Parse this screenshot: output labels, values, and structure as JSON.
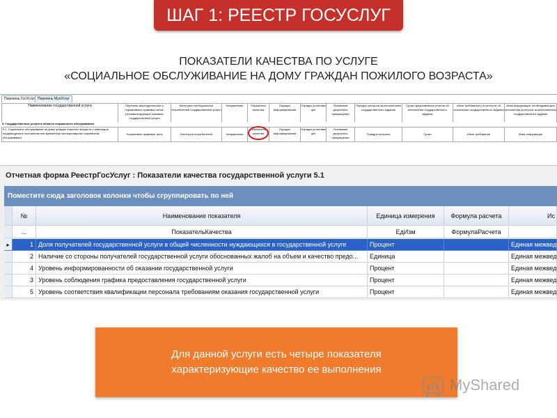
{
  "header": {
    "title": "ШАГ 1: РЕЕСТР ГОСУСЛУГ"
  },
  "subtitle": {
    "line1": "ПОКАЗАТЕЛИ КАЧЕСТВА ПО УСЛУГЕ",
    "line2": "«СОЦИАЛЬНОЕ ОБСЛУЖИВАНИЕ НА ДОМУ ГРАЖДАН ПОЖИЛОГО ВОЗРАСТА»"
  },
  "registry": {
    "tabs": [
      "Перечень ГосУслуг",
      "Перечень МунУслуг"
    ],
    "headers": [
      "Наименование государственной услуги",
      "Перечень законодательных и нормативных правовых актов, регламентирующих оказание государственной услуги",
      "Категории потенциальных потребителей государственной услуги",
      "Направления",
      "Показатели качества",
      "Порядок информирования",
      "Порядок установки цен",
      "Основания досрочного прекращения",
      "Порядок контроля за исполнением государственного задания",
      "Сроки представления отчетов об исполнении государственного задания",
      "Иные требования к отчетности об исполнении государственного задания",
      "Иная информация, необходимая для исполнения (контроля за исполнением) государственного задания"
    ],
    "section": "5. Государственные услуги в области социального обслуживания",
    "row_name": "5.1. Социальное обслуживание на дому граждан пожилого возраста и инвалидов, нуждающихся в постоянном или временном нестационарном социальном обслуживании",
    "row_cells": [
      "Нормативно правовые акты",
      "Категории потребителей",
      "Направления",
      "Показатели качества",
      "Порядок информирования",
      "Порядок установки цен",
      "Основания досрочного прекращения",
      "Порядок контроля",
      "Сроки",
      "Иные требования",
      "Иная информация"
    ]
  },
  "grid": {
    "title": "Отчетная форма РеестрГосУслуг : Показатели качества государственной услуги 5.1",
    "group_panel": "Поместите сюда заголовок колонки чтобы сгруппировать по ней",
    "columns": [
      "№",
      "Наименование показателя",
      "Единица измерения",
      "Формула расчета",
      "Ис"
    ],
    "filter": [
      "...",
      "ПоказательКачества",
      "ЕдИзм",
      "ФормулаРасчета",
      ""
    ],
    "rows": [
      {
        "num": "1",
        "name": "Доля получателей государственной услуги в общей численности нуждающихся в государственной услуге",
        "unit": "Процент",
        "formula": "",
        "source": "Единая межвед"
      },
      {
        "num": "2",
        "name": "Наличие со стороны получателей государственной услуги обоснованных жалоб на объем и качество предо...",
        "unit": "Единица",
        "formula": "",
        "source": "Единая межвед"
      },
      {
        "num": "4",
        "name": "Уровень информированности об оказании государственной услуги",
        "unit": "Процент",
        "formula": "",
        "source": "Единая межвед"
      },
      {
        "num": "3",
        "name": "Уровень соблюдения графика предоставления государственной услуги",
        "unit": "Процент",
        "formula": "",
        "source": "Единая межвед"
      },
      {
        "num": "5",
        "name": "Уровень соответствия квалификации персонала требованиям оказания государственной услуги",
        "unit": "Процент",
        "formula": "",
        "source": "Единая межвед"
      }
    ],
    "selected_indicator": "▸"
  },
  "callout": {
    "line1": "Для данной услуги есть четыре показателя",
    "line2": "характеризующие качество ее выполнения"
  },
  "watermark": {
    "brand": "MyShared"
  },
  "colors": {
    "header_red": "#c5312a",
    "group_panel_blue": "#6d8fbe",
    "selected_row_blue": "#2b62c7",
    "callout_orange": "#f07b2c",
    "highlight_ring_red": "#d21b1b"
  }
}
